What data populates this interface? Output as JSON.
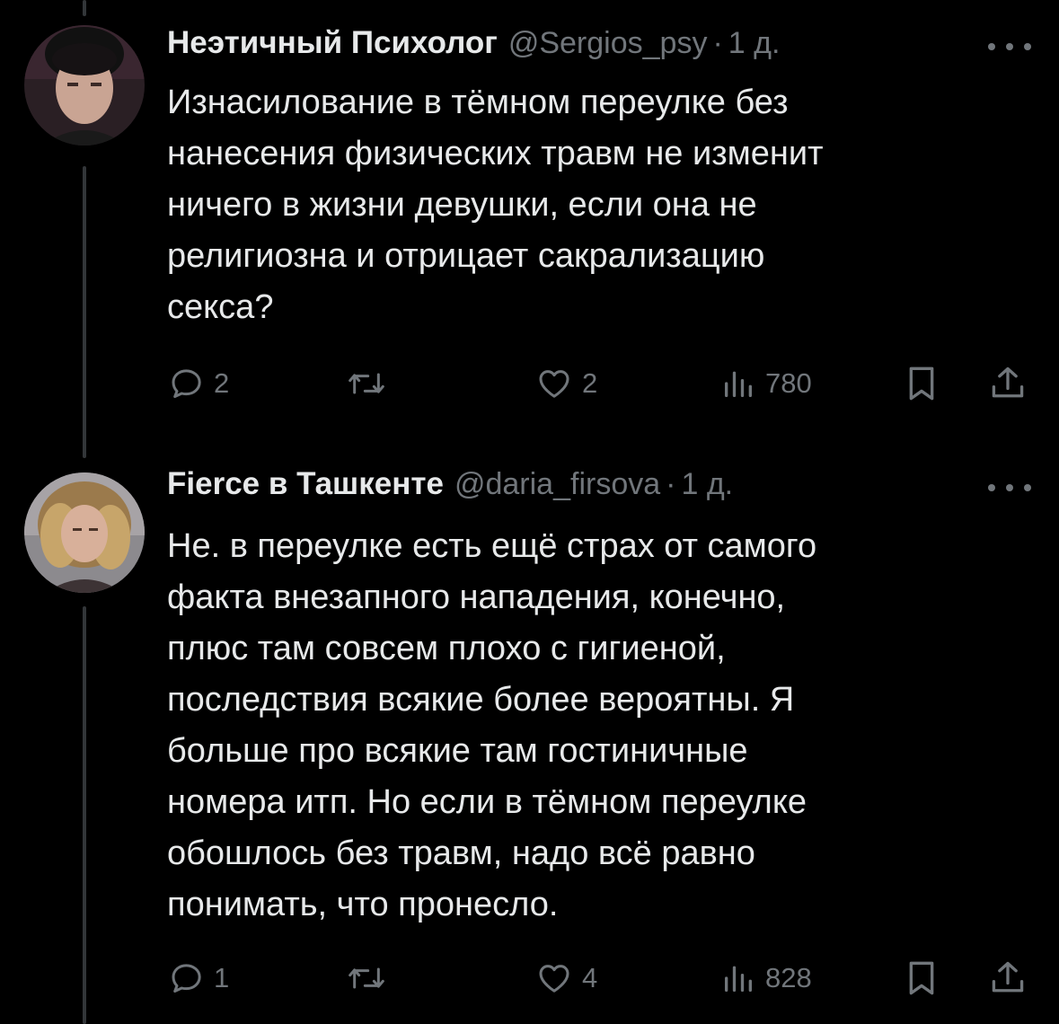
{
  "tweets": [
    {
      "display_name": "Неэтичный Психолог",
      "handle": "@Sergios_psy",
      "separator": "·",
      "time": "1 д.",
      "text_lines": [
        "Изнасилование в тёмном переулке без",
        "нанесения физических травм не изменит",
        "ничего в жизни девушки, если она не",
        "религиозна и отрицает сакрализацию",
        "секса?"
      ],
      "replies": "2",
      "retweets": "",
      "likes": "2",
      "views": "780",
      "icons": [
        "reply-icon",
        "retweet-icon",
        "like-icon",
        "views-icon",
        "bookmark-icon",
        "share-icon"
      ]
    },
    {
      "display_name": "Fierce в Ташкенте",
      "handle": "@daria_firsova",
      "separator": "·",
      "time": "1 д.",
      "text_lines": [
        "Не. в переулке есть ещё страх от самого",
        "факта внезапного нападения, конечно,",
        "плюс там совсем плохо с гигиеной,",
        "последствия всякие более вероятны. Я",
        "больше про всякие там гостиничные",
        "номера итп. Но если в тёмном переулке",
        "обошлось без травм, надо всё равно",
        "понимать, что пронесло."
      ],
      "replies": "1",
      "retweets": "",
      "likes": "4",
      "views": "828",
      "icons": [
        "reply-icon",
        "retweet-icon",
        "like-icon",
        "views-icon",
        "bookmark-icon",
        "share-icon"
      ]
    }
  ],
  "colors": {
    "background": "#000000",
    "primary_text": "#e7e9ea",
    "secondary_text": "#71767b",
    "thread_line": "#333639"
  }
}
